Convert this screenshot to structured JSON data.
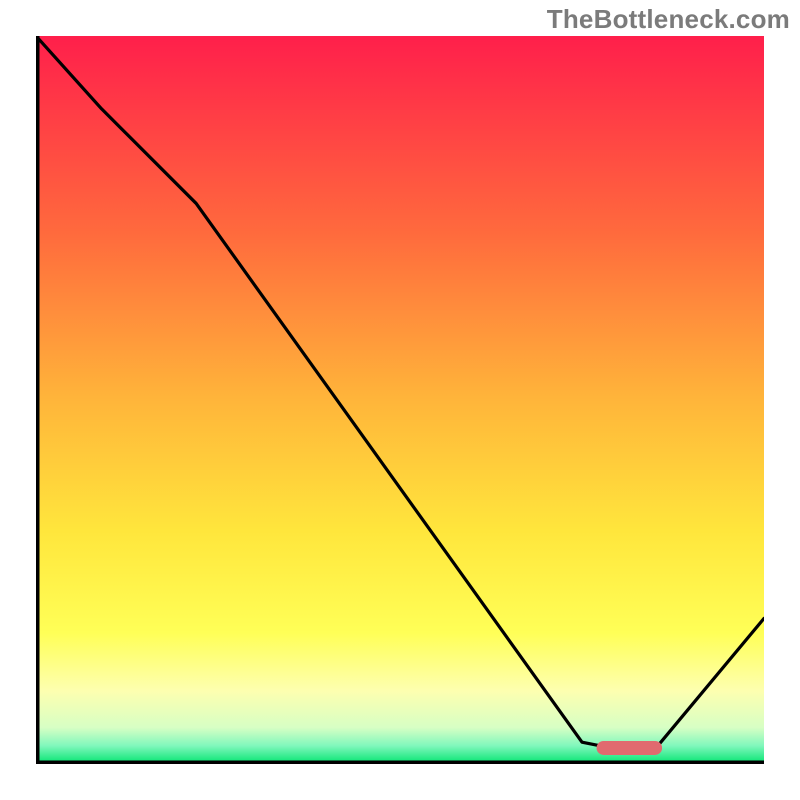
{
  "watermark": "TheBottleneck.com",
  "chart_data": {
    "type": "line",
    "title": "",
    "xlabel": "",
    "ylabel": "",
    "xlim": [
      0,
      100
    ],
    "ylim": [
      0,
      100
    ],
    "grid": false,
    "legend": false,
    "series": [
      {
        "name": "bottleneck-curve",
        "x": [
          0,
          9,
          22,
          75,
          80,
          85,
          100
        ],
        "y": [
          100,
          90,
          77,
          3,
          2,
          2,
          20
        ]
      }
    ],
    "optimal_marker": {
      "x_start": 77,
      "x_end": 86,
      "y": 2.2,
      "color": "#e16a6f"
    },
    "gradient_stops": [
      {
        "offset": 0.0,
        "color": "#ff1f4b"
      },
      {
        "offset": 0.27,
        "color": "#ff6a3d"
      },
      {
        "offset": 0.5,
        "color": "#ffb53a"
      },
      {
        "offset": 0.68,
        "color": "#ffe63c"
      },
      {
        "offset": 0.82,
        "color": "#ffff57"
      },
      {
        "offset": 0.9,
        "color": "#fdffb0"
      },
      {
        "offset": 0.95,
        "color": "#d7ffc4"
      },
      {
        "offset": 0.975,
        "color": "#80f7bc"
      },
      {
        "offset": 1.0,
        "color": "#00e56f"
      }
    ],
    "axis_color": "#000000",
    "line_color": "#000000"
  }
}
